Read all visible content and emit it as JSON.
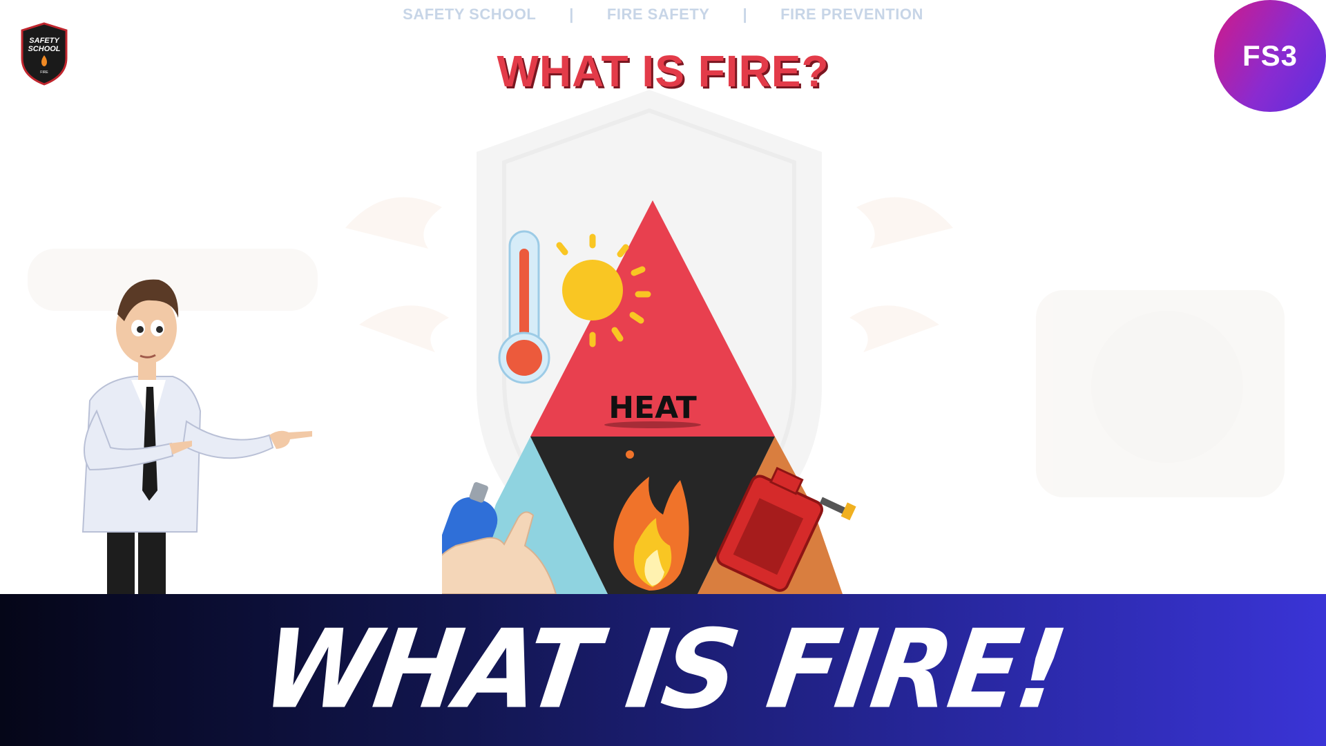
{
  "nav": {
    "items": [
      "SAFETY SCHOOL",
      "FIRE SAFETY",
      "FIRE PREVENTION"
    ],
    "separator": "|"
  },
  "logo": {
    "text_line1": "SAFETY",
    "text_line2": "SCHOOL",
    "text_line3": "FIRE"
  },
  "badge": {
    "label": "FS3"
  },
  "title": "WHAT IS FIRE?",
  "pyramid": {
    "top_label": "HEAT",
    "colors": {
      "heat": "#e8404f",
      "center": "#262626",
      "oxygen": "#8fd3e0",
      "fuel": "#d97e3f"
    }
  },
  "banner": {
    "text": "WHAT IS FIRE!"
  },
  "icons": [
    "shield-logo-icon",
    "thermometer-icon",
    "sun-icon",
    "flame-icon",
    "oxygen-canister-icon",
    "fuel-can-icon",
    "hand-icon",
    "presenter-character"
  ]
}
